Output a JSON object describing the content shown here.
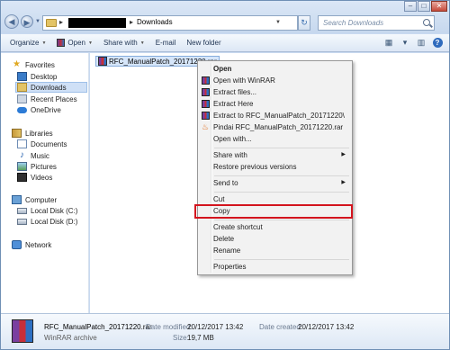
{
  "address": {
    "current_folder": "Downloads"
  },
  "search": {
    "placeholder": "Search Downloads"
  },
  "toolbar": {
    "organize": "Organize",
    "open": "Open",
    "share_with": "Share with",
    "email": "E-mail",
    "new_folder": "New folder"
  },
  "sidebar": {
    "favorites": "Favorites",
    "desktop": "Desktop",
    "downloads": "Downloads",
    "recent_places": "Recent Places",
    "onedrive": "OneDrive",
    "libraries": "Libraries",
    "documents": "Documents",
    "music": "Music",
    "pictures": "Pictures",
    "videos": "Videos",
    "computer": "Computer",
    "local_c": "Local Disk (C:)",
    "local_d": "Local Disk (D:)",
    "network": "Network"
  },
  "file": {
    "name": "RFC_ManualPatch_20171220.rar"
  },
  "context_menu": {
    "open": "Open",
    "open_winrar": "Open with WinRAR",
    "extract_files": "Extract files...",
    "extract_here": "Extract Here",
    "extract_to": "Extract to RFC_ManualPatch_20171220\\",
    "pindai": "Pindai RFC_ManualPatch_20171220.rar",
    "open_with": "Open with...",
    "share_with": "Share with",
    "restore": "Restore previous versions",
    "send_to": "Send to",
    "cut": "Cut",
    "copy": "Copy",
    "create_shortcut": "Create shortcut",
    "delete": "Delete",
    "rename": "Rename",
    "properties": "Properties"
  },
  "details": {
    "name": "RFC_ManualPatch_20171220.rar",
    "type": "WinRAR archive",
    "date_modified_label": "Date modified:",
    "date_modified": "20/12/2017 13:42",
    "date_created_label": "Date created:",
    "date_created": "20/12/2017 13:42",
    "size_label": "Size:",
    "size": "19,7 MB"
  },
  "colors": {
    "highlight_box": "#d3141e",
    "selection": "#cfe0f6"
  }
}
